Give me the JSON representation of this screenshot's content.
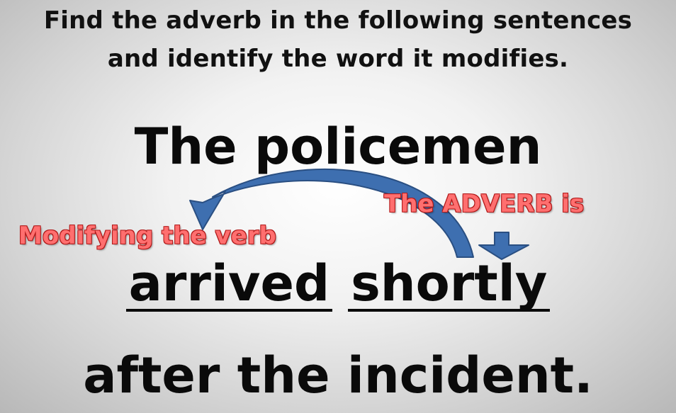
{
  "prompt": {
    "line1": "Find the adverb in the following sentences",
    "line2": "and identify the word it modifies."
  },
  "sentence": {
    "line1": "The policemen",
    "verb": "arrived",
    "adverb": "shortly",
    "line3": "after the incident."
  },
  "annotations": {
    "modifying_label": "Modifying the verb",
    "adverb_label": "The ADVERB is"
  },
  "colors": {
    "arrow_fill": "#3e6fb0",
    "arrow_stroke": "#2a4f82",
    "label_fill": "#ff6f6f",
    "label_outline": "#b01818"
  }
}
